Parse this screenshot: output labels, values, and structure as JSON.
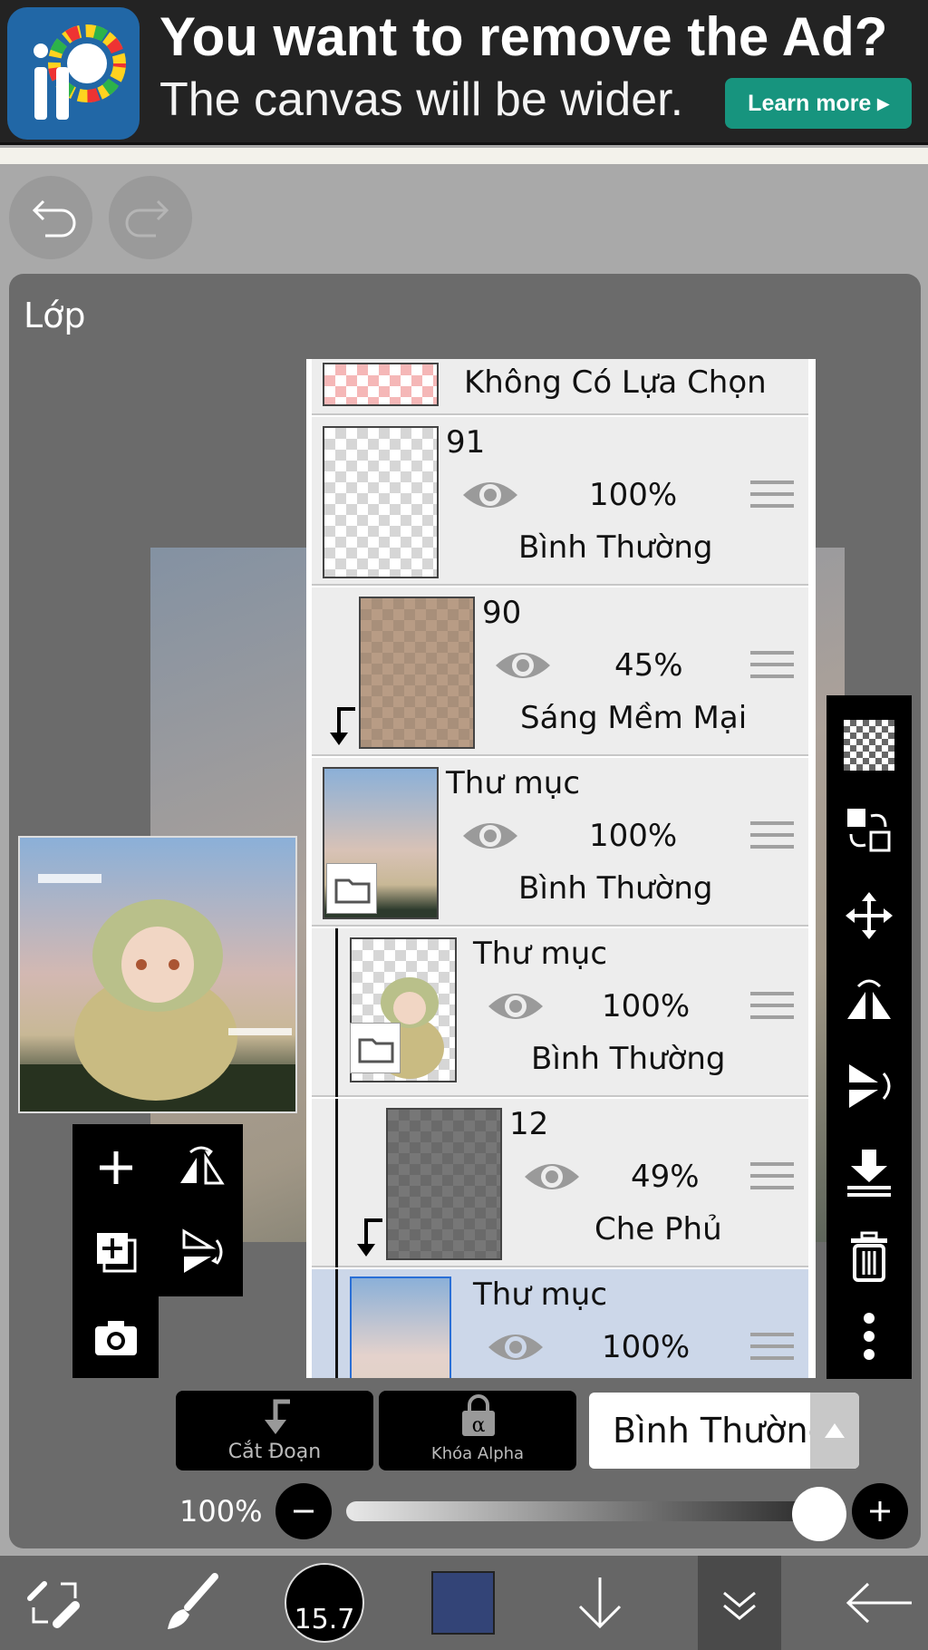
{
  "ad": {
    "title": "You want to remove the Ad?",
    "subtitle": "The canvas will be wider.",
    "button_label": "Learn more ▸"
  },
  "panel": {
    "title": "Lớp"
  },
  "layers": {
    "selection_layer_label": "Không Có Lựa Chọn",
    "items": [
      {
        "name": "91",
        "opacity": "100%",
        "mode": "Bình Thường"
      },
      {
        "name": "90",
        "opacity": "45%",
        "mode": "Sáng Mềm Mại"
      },
      {
        "name": "Thư mục",
        "opacity": "100%",
        "mode": "Bình Thường"
      },
      {
        "name": "Thư mục",
        "opacity": "100%",
        "mode": "Bình Thường"
      },
      {
        "name": "12",
        "opacity": "49%",
        "mode": "Che Phủ"
      },
      {
        "name": "Thư mục",
        "opacity": "100%",
        "mode": ""
      }
    ]
  },
  "controls": {
    "clipping_label": "Cắt Đoạn",
    "alpha_lock_label": "Khóa Alpha",
    "blend_mode": "Bình Thường",
    "opacity_label": "100%",
    "opacity_value": 1.0
  },
  "bottom_bar": {
    "brush_size": "15.7",
    "current_color": "#334477"
  }
}
